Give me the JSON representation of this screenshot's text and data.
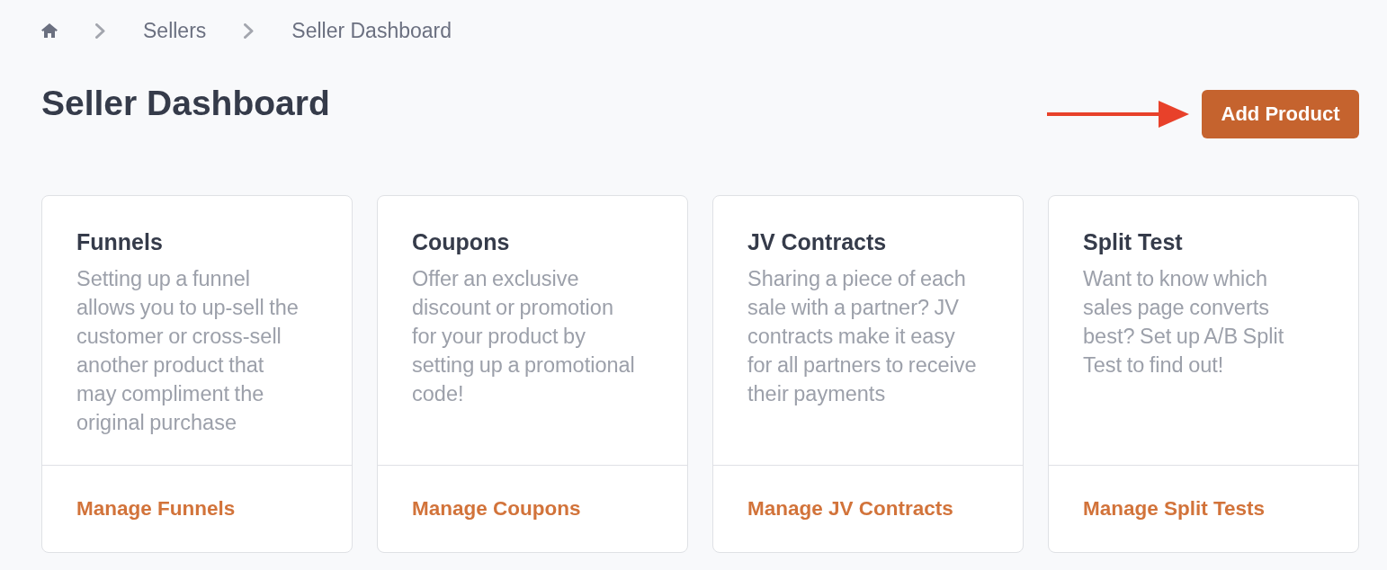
{
  "breadcrumb": [
    "Sellers",
    "Seller Dashboard"
  ],
  "page_title": "Seller Dashboard",
  "primary_button": "Add Product",
  "cards": [
    {
      "title": "Funnels",
      "description": "Setting up a funnel allows you to up-sell the customer or cross-sell another product that may compliment the original purchase",
      "link": "Manage Funnels"
    },
    {
      "title": "Coupons",
      "description": "Offer an exclusive discount or promotion for your product by setting up a promotional code!",
      "link": "Manage Coupons"
    },
    {
      "title": "JV Contracts",
      "description": "Sharing a piece of each sale with a partner? JV contracts make it easy for all partners to receive their payments",
      "link": "Manage JV Contracts"
    },
    {
      "title": "Split Test",
      "description": "Want to know which sales page converts best? Set up A/B Split Test to find out!",
      "link": "Manage Split Tests"
    }
  ]
}
